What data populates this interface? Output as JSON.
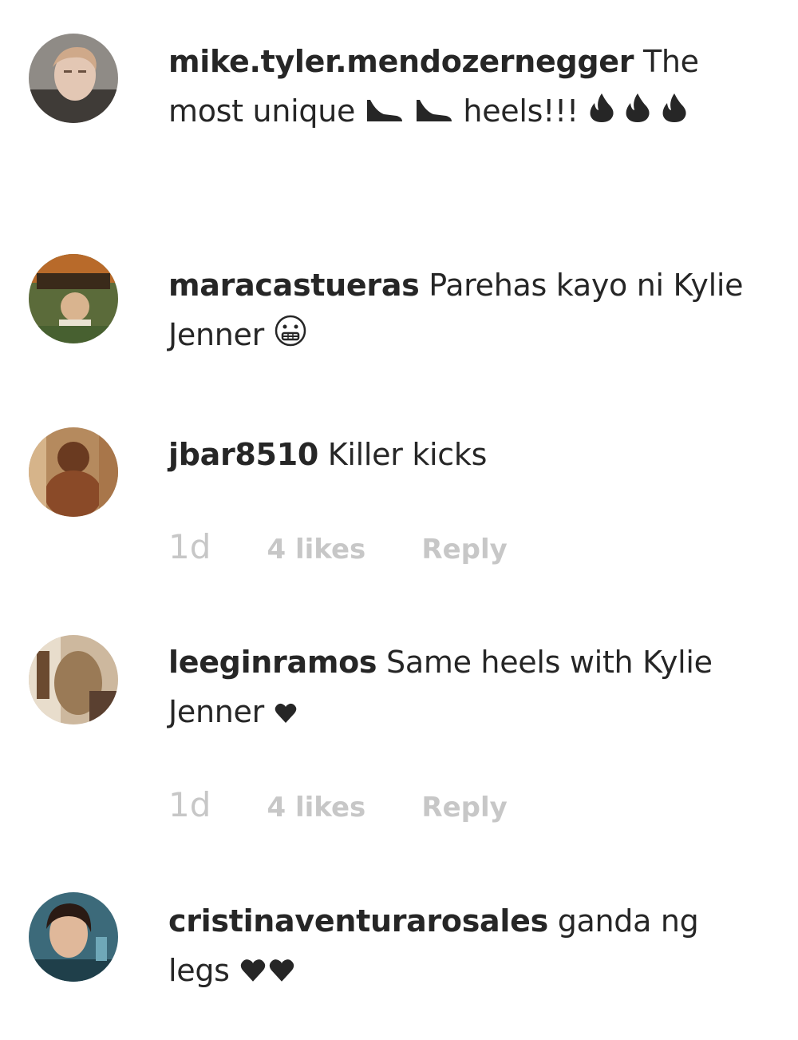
{
  "comments": [
    {
      "username": "mike.tyler.mendozernegger",
      "text_a": "The most unique",
      "text_b": "heels!!!",
      "icons": [
        "high-heel-icon",
        "high-heel-icon",
        "fire-icon",
        "fire-icon",
        "fire-icon"
      ]
    },
    {
      "username": "maracastueras",
      "text": "Parehas kayo ni Kylie Jenner",
      "icons": [
        "grimace-emoji-icon"
      ]
    },
    {
      "username": "jbar8510",
      "text": "Killer kicks",
      "time": "1d",
      "likes": "4 likes",
      "reply": "Reply"
    },
    {
      "username": "leeginramos",
      "text": "Same heels with Kylie Jenner",
      "icons": [
        "heart-icon"
      ],
      "time": "1d",
      "likes": "4 likes",
      "reply": "Reply"
    },
    {
      "username": "cristinaventurarosales",
      "text": "ganda ng legs",
      "icons": [
        "heart-icon",
        "heart-icon"
      ]
    }
  ]
}
